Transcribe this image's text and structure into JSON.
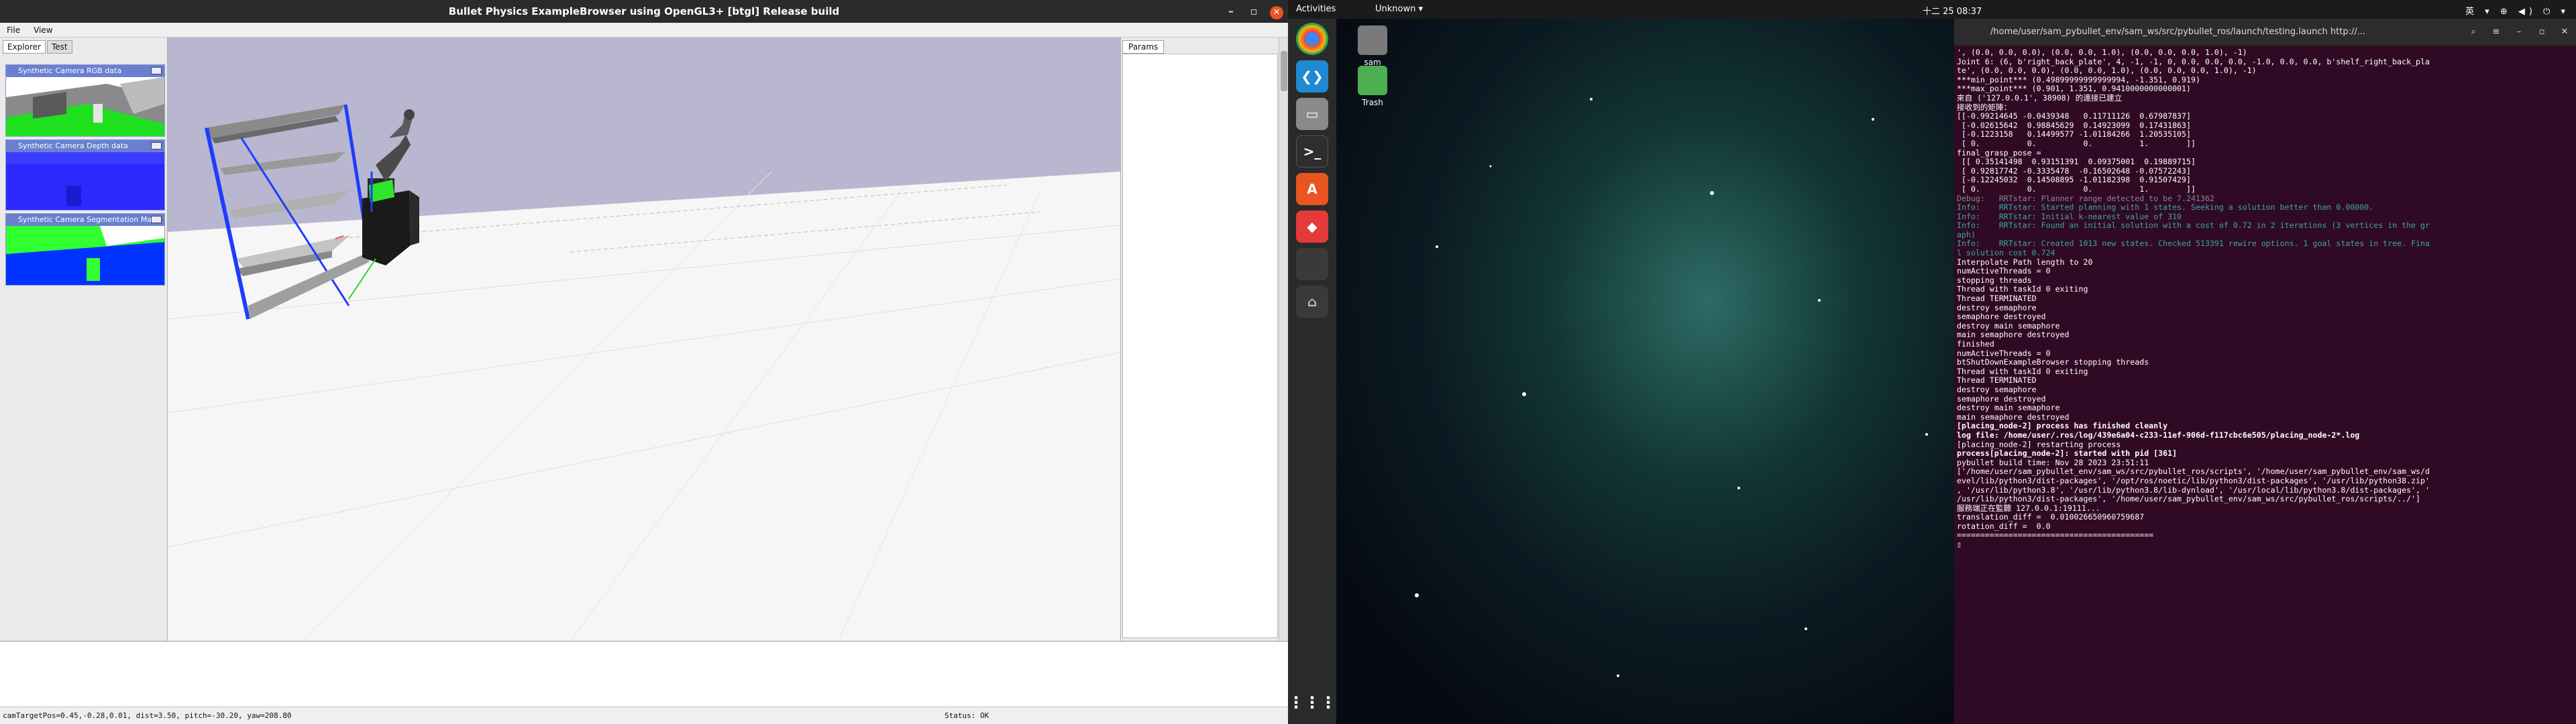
{
  "bullet": {
    "title": "Bullet Physics ExampleBrowser using OpenGL3+ [btgl] Release build",
    "window_controls": [
      "–",
      "▫",
      "✕"
    ],
    "menu": [
      "File",
      "View"
    ],
    "tabs": [
      "Explorer",
      "Test"
    ],
    "panels": [
      "Synthetic Camera RGB data",
      "Synthetic Camera Depth data",
      "Synthetic Camera Segmentation Mask"
    ],
    "params_tab": "Params",
    "status_left": "camTargetPos=0.45,-0.28,0.01, dist=3.50, pitch=-30.20, yaw=208.80",
    "status_right": "Status: OK"
  },
  "topbar": {
    "activities": "Activities",
    "app": "Unknown ▾",
    "clock": "十二 25  08:37",
    "tray": "英 ▾ ⊕ ◀) ⏻ ▾"
  },
  "desktop": {
    "icons": [
      "sam",
      "Trash"
    ]
  },
  "dock": {
    "icons": [
      "chrome-icon",
      "vscode-icon",
      "files-icon",
      "terminal-icon",
      "software-icon",
      "anydesk-icon",
      "blank-icon",
      "usb-icon",
      "apps-grid-icon"
    ]
  },
  "terminal": {
    "title": "/home/user/sam_pybullet_env/sam_ws/src/pybullet_ros/launch/testing.launch http://...",
    "lines": [
      {
        "t": "', (0.0, 0.0, 0.0), (0.0, 0.0, 1.0), (0.0, 0.0, 0.0, 1.0), -1)",
        "c": ""
      },
      {
        "t": "Joint 6: (6, b'right_back_plate', 4, -1, -1, 0, 0.0, 0.0, 0.0, -1.0, 0.0, 0.0, b'shelf_right_back_pla",
        "c": ""
      },
      {
        "t": "te', (0.0, 0.0, 0.0), (0.0, 0.0, 1.0), (0.0, 0.0, 0.0, 1.0), -1)",
        "c": ""
      },
      {
        "t": "***min_point*** (0.49899999999999994, -1.351, 0.919)",
        "c": ""
      },
      {
        "t": "***max_point*** (0.901, 1.351, 0.9410000000000001)",
        "c": ""
      },
      {
        "t": "來自 ('127.0.0.1', 38908) 的連接已建立",
        "c": ""
      },
      {
        "t": "接收到的矩陣：",
        "c": ""
      },
      {
        "t": "[[-0.99214645 -0.0439348   0.11711126  0.67987837]",
        "c": ""
      },
      {
        "t": " [-0.02615642  0.98845629  0.14923099  0.17431863]",
        "c": ""
      },
      {
        "t": " [-0.1223158   0.14499577 -1.01184266  1.20535105]",
        "c": ""
      },
      {
        "t": " [ 0.          0.          0.          1.        ]]",
        "c": ""
      },
      {
        "t": "final_grasp_pose =",
        "c": ""
      },
      {
        "t": " [[ 0.35141498  0.93151391  0.09375001  0.19889715]",
        "c": ""
      },
      {
        "t": " [ 0.92817742 -0.3335478  -0.16502648 -0.07572243]",
        "c": ""
      },
      {
        "t": " [-0.12245032  0.14508895 -1.01182398  0.91507429]",
        "c": ""
      },
      {
        "t": " [ 0.          0.          0.          1.        ]]",
        "c": ""
      },
      {
        "t": "Debug:   RRTstar: Planner range detected to be 7.241362",
        "c": "dbg"
      },
      {
        "t": "Info:    RRTstar: Started planning with 1 states. Seeking a solution better than 0.00000.",
        "c": "info"
      },
      {
        "t": "Info:    RRTstar: Initial k-nearest value of 310",
        "c": "info"
      },
      {
        "t": "Info:    RRTstar: Found an initial solution with a cost of 0.72 in 2 iterations (3 vertices in the gr",
        "c": "info"
      },
      {
        "t": "aph)",
        "c": "info"
      },
      {
        "t": "Info:    RRTstar: Created 1013 new states. Checked 513391 rewire options. 1 goal states in tree. Fina",
        "c": "info"
      },
      {
        "t": "l solution cost 0.724",
        "c": "info"
      },
      {
        "t": "Interpolate Path length to 20",
        "c": ""
      },
      {
        "t": "numActiveThreads = 0",
        "c": ""
      },
      {
        "t": "stopping threads",
        "c": ""
      },
      {
        "t": "Thread with taskId 0 exiting",
        "c": ""
      },
      {
        "t": "Thread TERMINATED",
        "c": ""
      },
      {
        "t": "destroy semaphore",
        "c": ""
      },
      {
        "t": "semaphore destroyed",
        "c": ""
      },
      {
        "t": "destroy main semaphore",
        "c": ""
      },
      {
        "t": "main semaphore destroyed",
        "c": ""
      },
      {
        "t": "finished",
        "c": ""
      },
      {
        "t": "numActiveThreads = 0",
        "c": ""
      },
      {
        "t": "btShutDownExampleBrowser stopping threads",
        "c": ""
      },
      {
        "t": "Thread with taskId 0 exiting",
        "c": ""
      },
      {
        "t": "Thread TERMINATED",
        "c": ""
      },
      {
        "t": "destroy semaphore",
        "c": ""
      },
      {
        "t": "semaphore destroyed",
        "c": ""
      },
      {
        "t": "destroy main semaphore",
        "c": ""
      },
      {
        "t": "main semaphore destroyed",
        "c": ""
      },
      {
        "t": "[placing_node-2] process has finished cleanly",
        "c": "b"
      },
      {
        "t": "log file: /home/user/.ros/log/439e6a04-c233-11ef-906d-f117cbc6e505/placing_node-2*.log",
        "c": "b"
      },
      {
        "t": "[placing_node-2] restarting process",
        "c": ""
      },
      {
        "t": "process[placing_node-2]: started with pid [361]",
        "c": "b"
      },
      {
        "t": "pybullet build time: Nov 28 2023 23:51:11",
        "c": ""
      },
      {
        "t": "['/home/user/sam_pybullet_env/sam_ws/src/pybullet_ros/scripts', '/home/user/sam_pybullet_env/sam_ws/d",
        "c": ""
      },
      {
        "t": "evel/lib/python3/dist-packages', '/opt/ros/noetic/lib/python3/dist-packages', '/usr/lib/python38.zip'",
        "c": ""
      },
      {
        "t": ", '/usr/lib/python3.8', '/usr/lib/python3.8/lib-dynload', '/usr/local/lib/python3.8/dist-packages', '",
        "c": ""
      },
      {
        "t": "/usr/lib/python3/dist-packages', '/home/user/sam_pybullet_env/sam_ws/src/pybullet_ros/scripts/../']",
        "c": ""
      },
      {
        "t": "服務端正在監聽 127.0.0.1:19111...",
        "c": ""
      },
      {
        "t": "translation_diff =  0.010026650960759687",
        "c": ""
      },
      {
        "t": "rotation_diff =  0.0",
        "c": ""
      },
      {
        "t": "==========================================",
        "c": ""
      },
      {
        "t": "▯",
        "c": ""
      }
    ]
  }
}
